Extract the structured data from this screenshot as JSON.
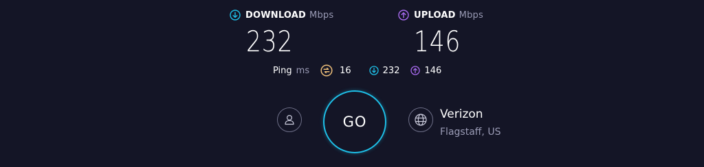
{
  "colors": {
    "background": "#141526",
    "download_accent": "#1ec0e8",
    "upload_accent": "#a96bf0",
    "ping_accent": "#f0c07a",
    "muted_text": "#9a9bb5"
  },
  "download": {
    "icon": "arrow-down-circle-icon",
    "label": "DOWNLOAD",
    "unit": "Mbps",
    "value": "232"
  },
  "upload": {
    "icon": "arrow-up-circle-icon",
    "label": "UPLOAD",
    "unit": "Mbps",
    "value": "146"
  },
  "ping": {
    "label": "Ping",
    "unit": "ms",
    "idle": {
      "icon": "ping-idle-icon",
      "value": "16"
    },
    "download": {
      "icon": "arrow-down-circle-icon",
      "value": "232"
    },
    "upload": {
      "icon": "arrow-up-circle-icon",
      "value": "146"
    }
  },
  "go_button": {
    "label": "GO"
  },
  "user": {
    "icon": "user-icon"
  },
  "provider": {
    "icon": "globe-icon",
    "name": "Verizon",
    "location": "Flagstaff, US"
  }
}
